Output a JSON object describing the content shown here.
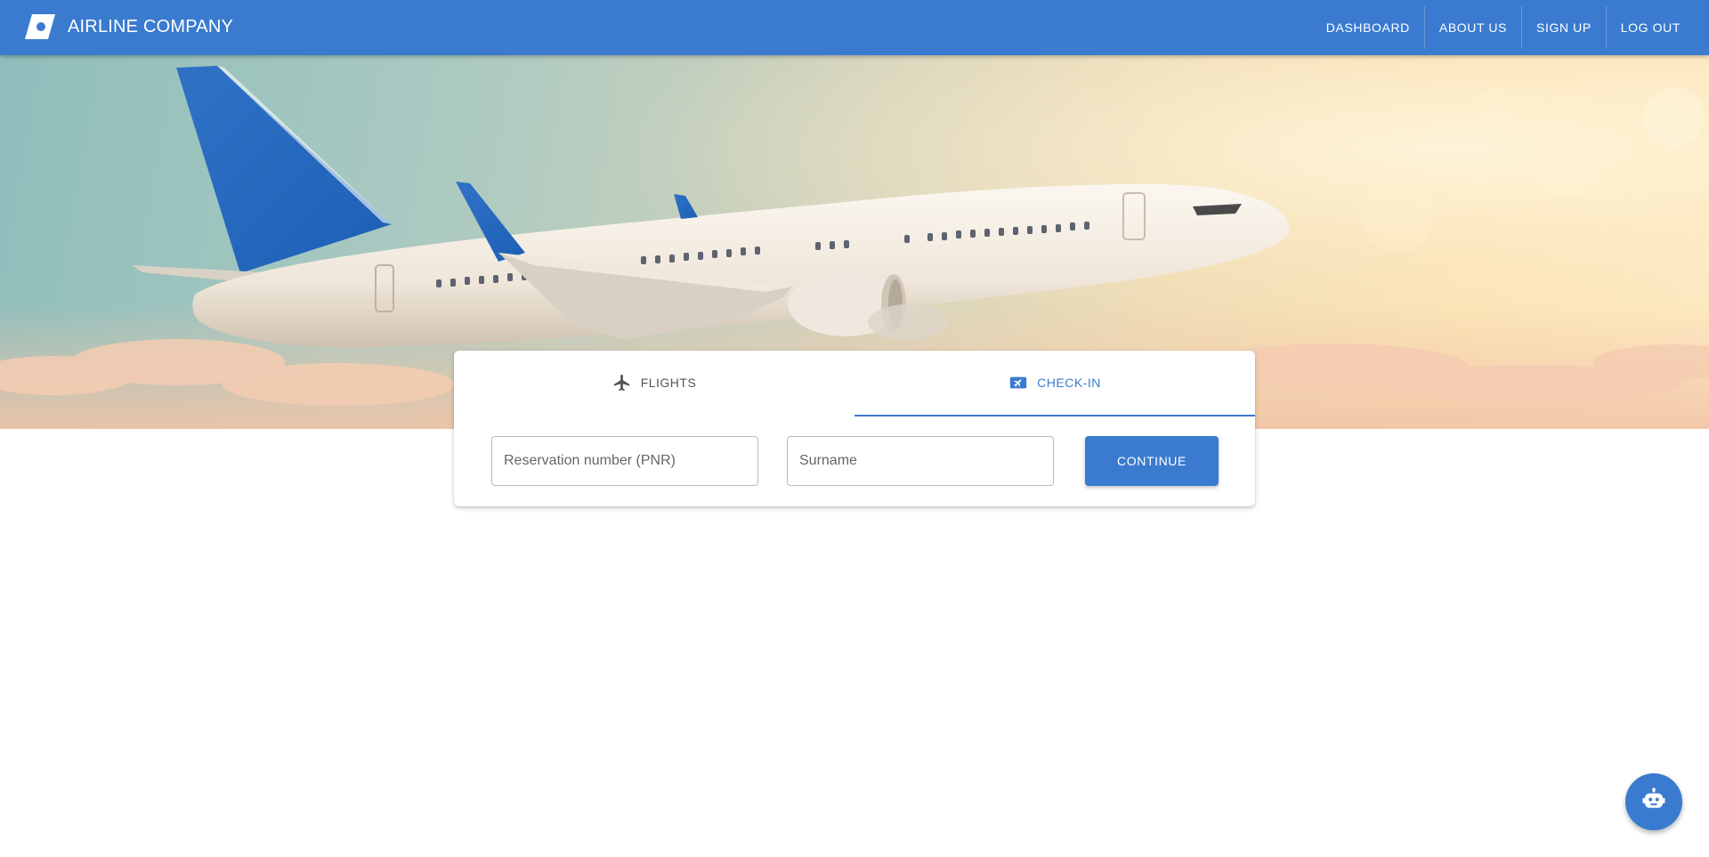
{
  "header": {
    "brand": "AIRLINE COMPANY",
    "nav": [
      "DASHBOARD",
      "ABOUT US",
      "SIGN UP",
      "LOG OUT"
    ]
  },
  "hero": {
    "image": "airplane-in-sky"
  },
  "booking": {
    "tabs": [
      {
        "label": "FLIGHTS",
        "icon": "airplane-icon",
        "active": false
      },
      {
        "label": "CHECK-IN",
        "icon": "boarding-pass-icon",
        "active": true
      }
    ],
    "pnr_placeholder": "Reservation number (PNR)",
    "surname_placeholder": "Surname",
    "continue_label": "CONTINUE"
  },
  "fab": {
    "icon": "robot-icon"
  },
  "colors": {
    "primary": "#3a7bd0",
    "text_muted": "#555555",
    "border": "#b9b9b9"
  }
}
